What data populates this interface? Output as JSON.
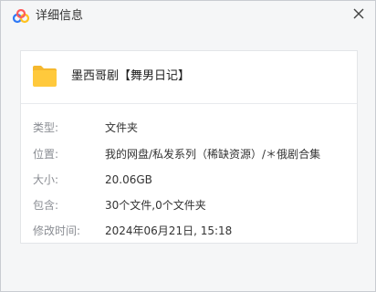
{
  "window": {
    "title": "详细信息",
    "logo_icon": "baidu-netdisk-cloud-icon",
    "close_icon": "close-icon",
    "brand_colors": [
      "#2f79f6",
      "#ff5b5b",
      "#ffc21f"
    ]
  },
  "file": {
    "icon": "folder-icon",
    "icon_color": "#ffc93c",
    "name": "墨西哥剧【舞男日记】"
  },
  "details": {
    "type_label": "类型:",
    "type_value": "文件夹",
    "location_label": "位置:",
    "location_value": "我的网盘/私发系列（稀缺资源）/＊俄剧合集",
    "size_label": "大小:",
    "size_value": "20.06GB",
    "contains_label": "包含:",
    "contains_value": "30个文件,0个文件夹",
    "modified_label": "修改时间:",
    "modified_value": "2024年06月21日, 15:18"
  }
}
